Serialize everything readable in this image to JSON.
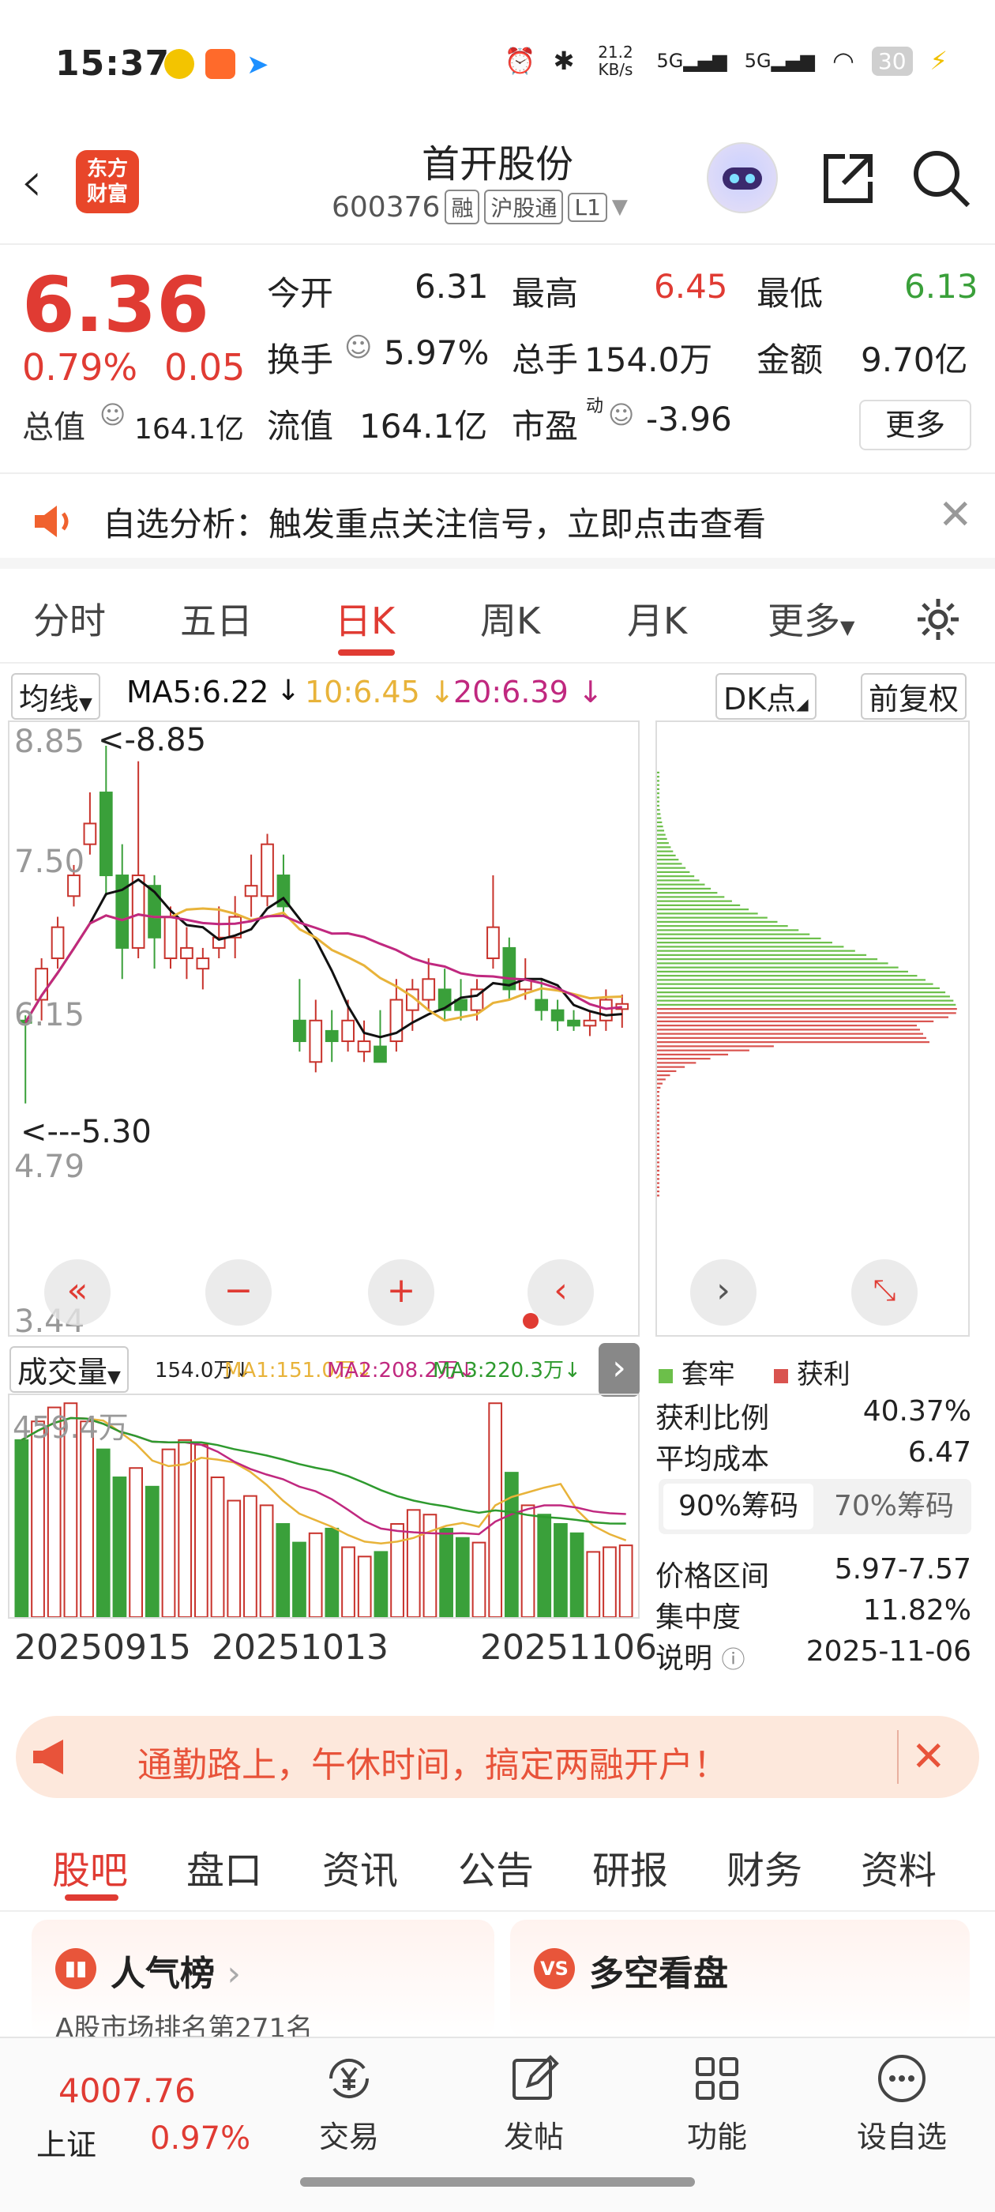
{
  "status": {
    "time": "15:37",
    "speed": "21.2 KB/s",
    "net1": "5G",
    "net2": "5G",
    "battery": "30"
  },
  "header": {
    "back_icon": "back-arrow-icon",
    "logo_line1": "东方",
    "logo_line2": "财富",
    "title": "首开股份",
    "code": "600376",
    "tag1": "融",
    "tag2": "沪股通",
    "tag3": "L1"
  },
  "quote": {
    "price": "6.36",
    "pct": "0.79%",
    "chg": "0.05",
    "row1": [
      {
        "label": "今开",
        "value": "6.31"
      },
      {
        "label": "最高",
        "value": "6.45"
      },
      {
        "label": "最低",
        "value": "6.13"
      }
    ],
    "row2": [
      {
        "label": "换手",
        "value": "5.97%"
      },
      {
        "label": "总手",
        "value": "154.0万"
      },
      {
        "label": "金额",
        "value": "9.70亿"
      }
    ],
    "zongzhi_label": "总值",
    "zongzhi_value": "164.1亿",
    "liuzhi_label": "流值",
    "liuzhi_value": "164.1亿",
    "shiying_label": "市盈",
    "shiying_sup": "动",
    "shiying_value": "-3.96",
    "more": "更多"
  },
  "alert": {
    "text": "自选分析：触发重点关注信号，立即点击查看"
  },
  "tabs": [
    "分时",
    "五日",
    "日K",
    "周K",
    "月K",
    "更多"
  ],
  "ma": {
    "selector": "均线",
    "ma5": "MA5:6.22",
    "ma10": "10:6.45",
    "ma20": "20:6.39",
    "dk": "DK点",
    "fuquan": "前复权"
  },
  "chart_data": {
    "type": "candlestick",
    "y_ticks": [
      "8.85",
      "7.50",
      "6.15",
      "4.79",
      "3.44"
    ],
    "ylim": [
      3.44,
      8.85
    ],
    "annot_high": "<-8.85",
    "annot_low": "<---5.30",
    "candles": [
      [
        6.2,
        6.25,
        5.4,
        6.18
      ],
      [
        6.4,
        6.8,
        6.2,
        6.7
      ],
      [
        6.8,
        7.2,
        6.7,
        7.1
      ],
      [
        7.4,
        7.7,
        7.3,
        7.6
      ],
      [
        7.9,
        8.4,
        7.8,
        8.1
      ],
      [
        8.4,
        8.85,
        7.4,
        7.6
      ],
      [
        7.6,
        7.9,
        6.6,
        6.9
      ],
      [
        6.9,
        8.7,
        6.8,
        7.6
      ],
      [
        7.5,
        7.6,
        6.7,
        7.0
      ],
      [
        6.8,
        7.3,
        6.7,
        7.2
      ],
      [
        6.8,
        7.1,
        6.6,
        6.9
      ],
      [
        6.7,
        6.9,
        6.5,
        6.8
      ],
      [
        6.9,
        7.3,
        6.8,
        7.0
      ],
      [
        7.0,
        7.4,
        6.8,
        7.2
      ],
      [
        7.4,
        7.8,
        7.2,
        7.5
      ],
      [
        7.4,
        8.0,
        7.3,
        7.9
      ],
      [
        7.6,
        7.8,
        7.2,
        7.3
      ],
      [
        6.2,
        6.6,
        5.9,
        6.0
      ],
      [
        5.8,
        6.4,
        5.7,
        6.2
      ],
      [
        6.1,
        6.3,
        5.8,
        6.0
      ],
      [
        6.0,
        6.4,
        5.9,
        6.2
      ],
      [
        5.9,
        6.2,
        5.8,
        6.0
      ],
      [
        5.95,
        6.3,
        5.9,
        5.8
      ],
      [
        6.0,
        6.6,
        5.9,
        6.4
      ],
      [
        6.3,
        6.6,
        6.1,
        6.5
      ],
      [
        6.4,
        6.8,
        6.3,
        6.6
      ],
      [
        6.5,
        6.7,
        6.2,
        6.3
      ],
      [
        6.4,
        6.6,
        6.2,
        6.3
      ],
      [
        6.3,
        6.6,
        6.2,
        6.5
      ],
      [
        6.8,
        7.6,
        6.7,
        7.1
      ],
      [
        6.9,
        7.0,
        6.4,
        6.5
      ],
      [
        6.5,
        6.8,
        6.4,
        6.6
      ],
      [
        6.4,
        6.6,
        6.2,
        6.3
      ],
      [
        6.3,
        6.4,
        6.1,
        6.2
      ],
      [
        6.2,
        6.3,
        6.1,
        6.15
      ],
      [
        6.15,
        6.3,
        6.05,
        6.2
      ],
      [
        6.2,
        6.5,
        6.1,
        6.4
      ],
      [
        6.31,
        6.45,
        6.13,
        6.36
      ]
    ],
    "volume_label": "成交量",
    "vol_info": "154.0万↓",
    "vma1": "MA1:151.0万↓",
    "vma2": "MA2:208.2万↓",
    "vma3": "MA3:220.3万↓",
    "vol_max": "459.4万",
    "volumes": [
      380,
      420,
      450,
      459,
      420,
      360,
      300,
      320,
      280,
      360,
      380,
      370,
      300,
      250,
      260,
      240,
      200,
      160,
      180,
      190,
      150,
      130,
      140,
      200,
      230,
      220,
      190,
      170,
      160,
      459,
      310,
      240,
      220,
      200,
      180,
      140,
      150,
      154
    ],
    "dates": [
      "20250915",
      "20251013",
      "20251106"
    ]
  },
  "chips": {
    "legend1": "套牢",
    "legend2": "获利",
    "rows": [
      {
        "label": "获利比例",
        "value": "40.37%"
      },
      {
        "label": "平均成本",
        "value": "6.47"
      }
    ],
    "tab1": "90%筹码",
    "tab2": "70%筹码",
    "rows2": [
      {
        "label": "价格区间",
        "value": "5.97-7.57"
      },
      {
        "label": "集中度",
        "value": "11.82%"
      },
      {
        "label": "说明",
        "value": "2025-11-06"
      }
    ]
  },
  "banner": {
    "text": "通勤路上，午休时间，搞定两融开户！"
  },
  "subtabs": [
    "股吧",
    "盘口",
    "资讯",
    "公告",
    "研报",
    "财务",
    "资料"
  ],
  "cards": [
    {
      "title": "人气榜",
      "sub": "A股市场排名第271名"
    },
    {
      "title": "多空看盘"
    }
  ],
  "bottom": {
    "index_value": "4007.76",
    "index_name": "上证",
    "index_pct": "0.97%",
    "items": [
      "交易",
      "发帖",
      "功能",
      "设自选"
    ]
  },
  "colors": {
    "red": "#e03b33",
    "green": "#3aa03a",
    "ma5": "#111111",
    "ma10": "#e8b33a",
    "ma20": "#c0287f"
  }
}
